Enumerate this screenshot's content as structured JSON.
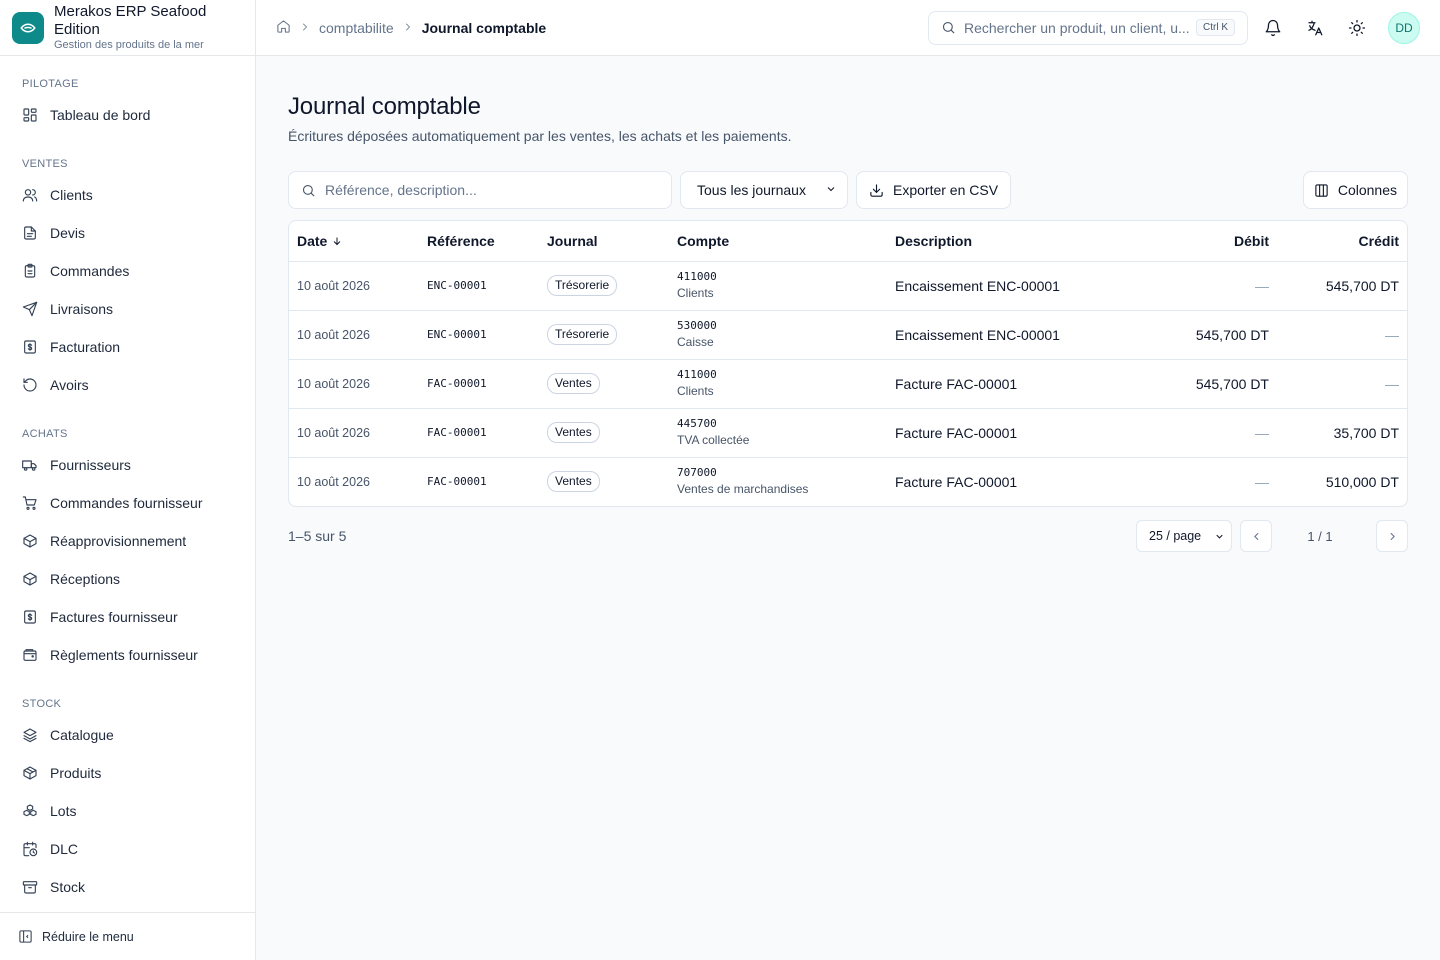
{
  "brand": {
    "title": "Merakos ERP Seafood Edition",
    "subtitle": "Gestion des produits de la mer"
  },
  "sidebar": {
    "sections": [
      {
        "label": "PILOTAGE",
        "items": [
          {
            "label": "Tableau de bord",
            "icon": "dashboard-icon"
          }
        ]
      },
      {
        "label": "VENTES",
        "items": [
          {
            "label": "Clients",
            "icon": "users-icon"
          },
          {
            "label": "Devis",
            "icon": "file-icon"
          },
          {
            "label": "Commandes",
            "icon": "clipboard-icon"
          },
          {
            "label": "Livraisons",
            "icon": "send-icon"
          },
          {
            "label": "Facturation",
            "icon": "invoice-icon"
          },
          {
            "label": "Avoirs",
            "icon": "undo-icon"
          }
        ]
      },
      {
        "label": "ACHATS",
        "items": [
          {
            "label": "Fournisseurs",
            "icon": "truck-icon"
          },
          {
            "label": "Commandes fournisseur",
            "icon": "cart-icon"
          },
          {
            "label": "Réapprovisionnement",
            "icon": "package-icon"
          },
          {
            "label": "Réceptions",
            "icon": "package-icon"
          },
          {
            "label": "Factures fournisseur",
            "icon": "invoice-icon"
          },
          {
            "label": "Règlements fournisseur",
            "icon": "wallet-icon"
          }
        ]
      },
      {
        "label": "STOCK",
        "items": [
          {
            "label": "Catalogue",
            "icon": "layers-icon"
          },
          {
            "label": "Produits",
            "icon": "box-icon"
          },
          {
            "label": "Lots",
            "icon": "boxes-icon"
          },
          {
            "label": "DLC",
            "icon": "calendar-clock-icon"
          },
          {
            "label": "Stock",
            "icon": "archive-icon"
          }
        ]
      }
    ],
    "collapse_label": "Réduire le menu"
  },
  "breadcrumb": {
    "parent": "comptabilite",
    "current": "Journal comptable"
  },
  "topbar": {
    "search_placeholder": "Rechercher un produit, un client, u...",
    "shortcut": "Ctrl K",
    "avatar": "DD"
  },
  "page": {
    "title": "Journal comptable",
    "subtitle": "Écritures déposées automatiquement par les ventes, les achats et les paiements."
  },
  "toolbar": {
    "search_placeholder": "Référence, description...",
    "journal_filter": "Tous les journaux",
    "export_label": "Exporter en CSV",
    "columns_label": "Colonnes"
  },
  "table": {
    "headers": {
      "date": "Date",
      "reference": "Référence",
      "journal": "Journal",
      "account": "Compte",
      "description": "Description",
      "debit": "Débit",
      "credit": "Crédit"
    },
    "rows": [
      {
        "date": "10 août 2026",
        "reference": "ENC-00001",
        "journal": "Trésorerie",
        "account_code": "411000",
        "account_name": "Clients",
        "description": "Encaissement ENC-00001",
        "debit": "—",
        "credit": "545,700 DT"
      },
      {
        "date": "10 août 2026",
        "reference": "ENC-00001",
        "journal": "Trésorerie",
        "account_code": "530000",
        "account_name": "Caisse",
        "description": "Encaissement ENC-00001",
        "debit": "545,700 DT",
        "credit": "—"
      },
      {
        "date": "10 août 2026",
        "reference": "FAC-00001",
        "journal": "Ventes",
        "account_code": "411000",
        "account_name": "Clients",
        "description": "Facture FAC-00001",
        "debit": "545,700 DT",
        "credit": "—"
      },
      {
        "date": "10 août 2026",
        "reference": "FAC-00001",
        "journal": "Ventes",
        "account_code": "445700",
        "account_name": "TVA collectée",
        "description": "Facture FAC-00001",
        "debit": "—",
        "credit": "35,700 DT"
      },
      {
        "date": "10 août 2026",
        "reference": "FAC-00001",
        "journal": "Ventes",
        "account_code": "707000",
        "account_name": "Ventes de marchandises",
        "description": "Facture FAC-00001",
        "debit": "—",
        "credit": "510,000 DT"
      }
    ]
  },
  "pagination": {
    "count": "1–5 sur 5",
    "page_size": "25 / page",
    "page_info": "1 / 1"
  },
  "colors": {
    "brand": "#0f8a8a",
    "border": "#e2e8f0",
    "text": "#0f172a",
    "muted": "#475569"
  }
}
